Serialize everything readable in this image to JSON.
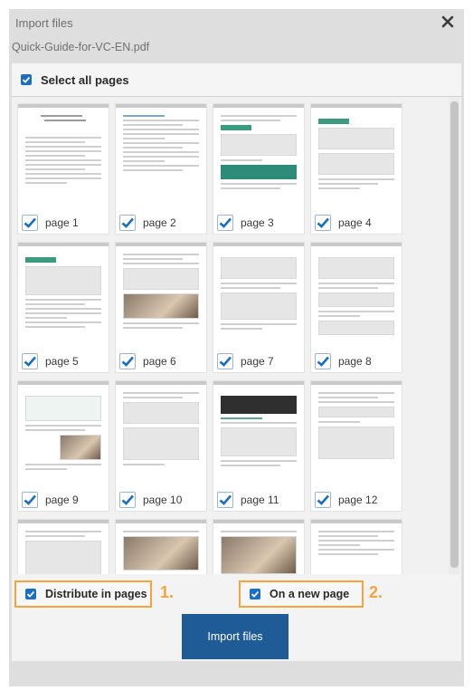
{
  "dialog": {
    "title": "Import files",
    "filename": "Quick-Guide-for-VC-EN.pdf",
    "select_all_label": "Select all pages"
  },
  "pages": [
    {
      "label": "page 1"
    },
    {
      "label": "page 2"
    },
    {
      "label": "page 3"
    },
    {
      "label": "page 4"
    },
    {
      "label": "page 5"
    },
    {
      "label": "page 6"
    },
    {
      "label": "page 7"
    },
    {
      "label": "page 8"
    },
    {
      "label": "page 9"
    },
    {
      "label": "page 10"
    },
    {
      "label": "page 11"
    },
    {
      "label": "page 12"
    },
    {
      "label": ""
    },
    {
      "label": ""
    },
    {
      "label": ""
    },
    {
      "label": ""
    }
  ],
  "options": {
    "distribute_label": "Distribute in pages",
    "distribute_number": "1.",
    "new_page_label": "On a new page",
    "new_page_number": "2."
  },
  "footer": {
    "import_label": "Import files"
  },
  "colors": {
    "accent": "#1f5b96",
    "checkbox": "#1b6ec2",
    "highlight": "#f5a43c"
  }
}
